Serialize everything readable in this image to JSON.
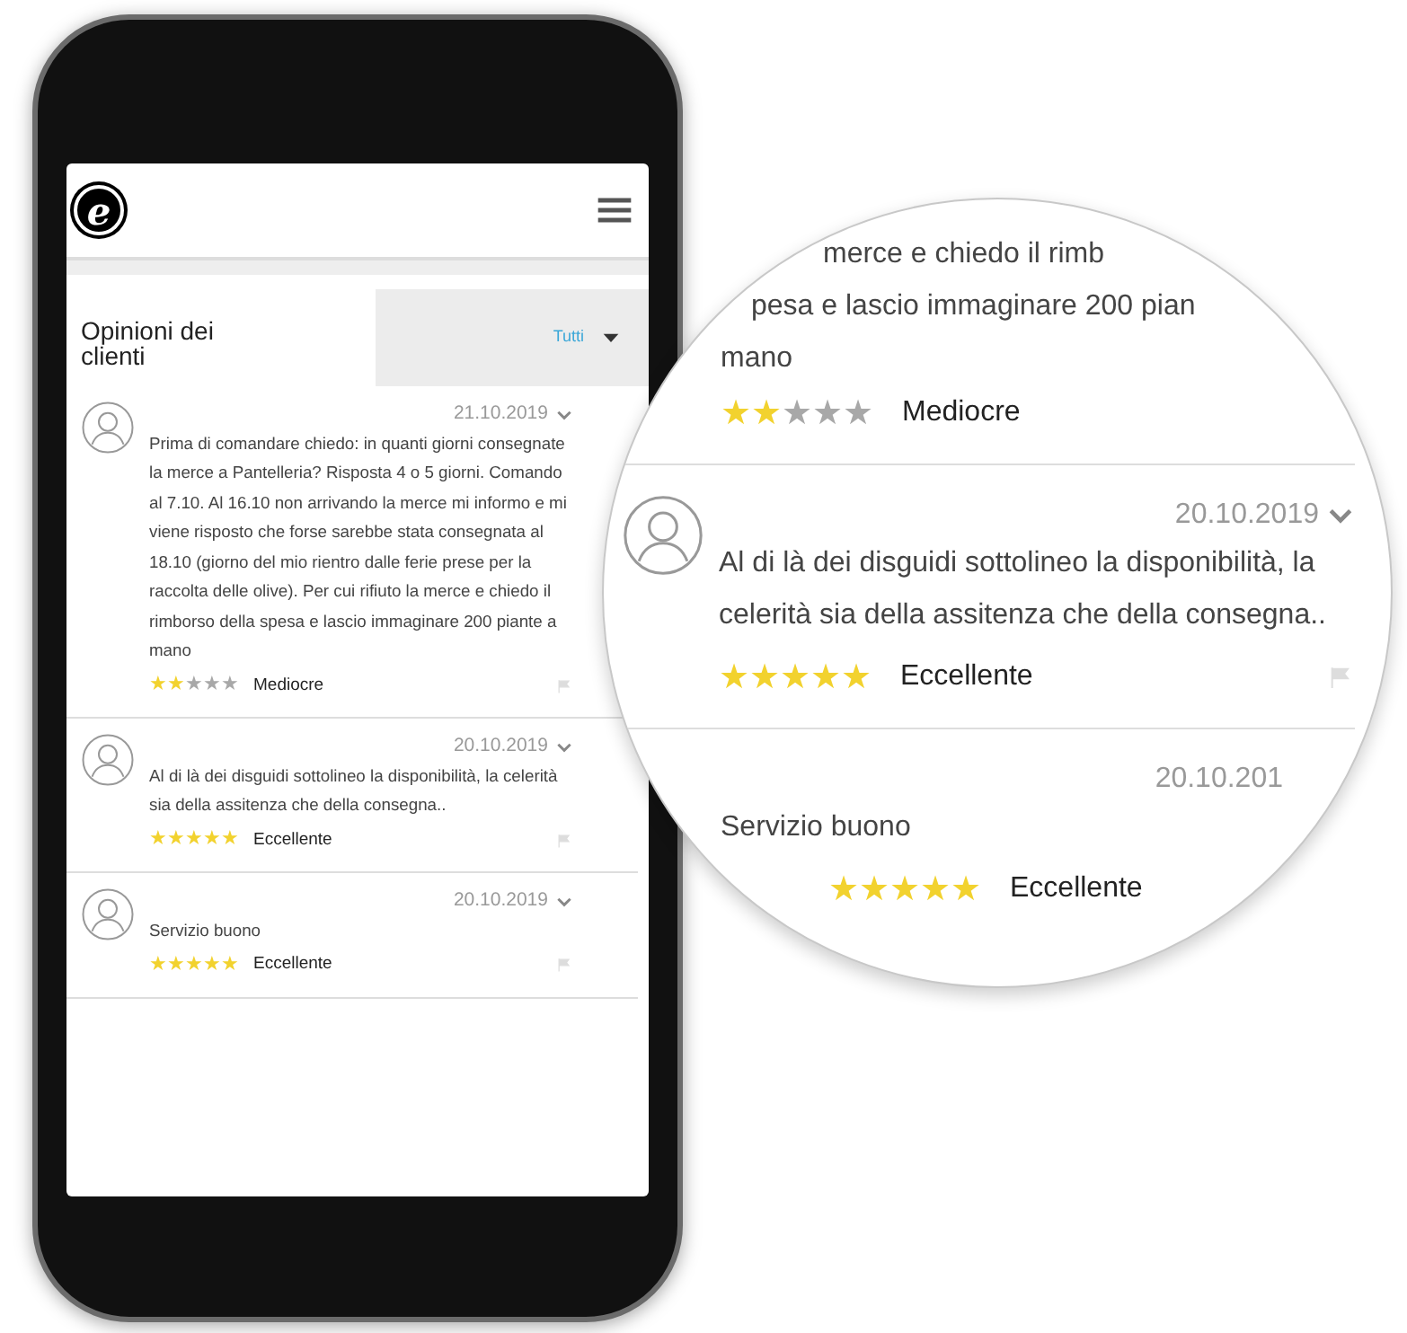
{
  "phone": {
    "logo": "e",
    "section_title": "Opinioni dei clienti",
    "filter": {
      "label": "Tutti"
    },
    "reviews": [
      {
        "date": "21.10.2019",
        "text": "Prima di comandare chiedo: in quanti giorni consegnate la merce a Pantelleria? Risposta 4 o 5 giorni. Comando al 7.10. Al 16.10 non arrivando la merce mi informo e mi viene risposto che forse sarebbe stata consegnata al 18.10 (giorno del mio rientro dalle ferie prese per la raccolta delle olive). Per cui rifiuto la merce e chiedo il rimborso della spesa e lascio immaginare 200 piante a mano",
        "stars": 2,
        "rating_label": "Mediocre"
      },
      {
        "date": "20.10.2019",
        "text": "Al di là dei disguidi sottolineo la disponibilità, la celerità sia della assitenza che della consegna..",
        "stars": 5,
        "rating_label": "Eccellente"
      },
      {
        "date": "20.10.2019",
        "text": "Servizio buono",
        "stars": 5,
        "rating_label": "Eccellente"
      }
    ]
  },
  "magnifier": {
    "partial_review": {
      "lines": [
        "merce e chiedo il rimb",
        "pesa e lascio immaginare 200 pian",
        "mano"
      ],
      "stars": 2,
      "rating_label": "Mediocre"
    },
    "reviews": [
      {
        "date": "20.10.2019",
        "text": "Al di là dei disguidi sottolineo la disponibilità, la celerità sia della assitenza che della consegna..",
        "stars": 5,
        "rating_label": "Eccellente"
      },
      {
        "date": "20.10.201",
        "text": "Servizio buono",
        "stars": 5,
        "rating_label": "Eccellente"
      }
    ]
  }
}
